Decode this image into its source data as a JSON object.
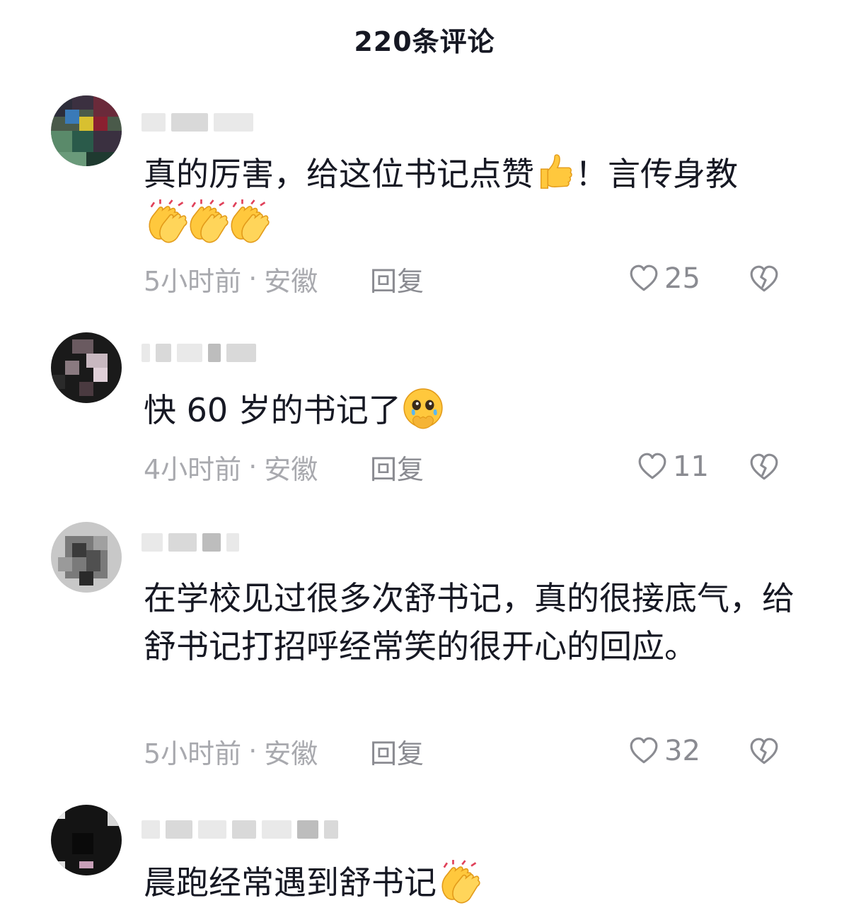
{
  "header": {
    "title": "220条评论"
  },
  "comments": [
    {
      "username": "",
      "text": "真的厉害，给这位书记点赞",
      "text_after_emoji": "！言传身教",
      "emojis": [
        "thumbs-up-emoji",
        "clapping-hands-emoji",
        "clapping-hands-emoji",
        "clapping-hands-emoji"
      ],
      "time": "5小时前",
      "separator": "·",
      "location": "安徽",
      "reply_label": "回复",
      "likes": "25"
    },
    {
      "username": "",
      "text": "快 60 岁的书记了",
      "emojis": [
        "face-holding-back-tears-emoji"
      ],
      "time": "4小时前",
      "separator": "·",
      "location": "安徽",
      "reply_label": "回复",
      "likes": "11"
    },
    {
      "username": "",
      "text": "在学校见过很多次舒书记，真的很接底气，给舒书记打招呼经常笑的很开心的回应。",
      "emojis": [],
      "time": "5小时前",
      "separator": "·",
      "location": "安徽",
      "reply_label": "回复",
      "likes": "32"
    },
    {
      "username": "",
      "text": "晨跑经常遇到舒书记",
      "emojis": [
        "clapping-hands-emoji"
      ]
    }
  ],
  "icons": {
    "like": "heart-outline-icon",
    "dislike": "broken-heart-icon"
  },
  "colors": {
    "text_primary": "#161823",
    "text_secondary": "#a8a9ae",
    "action_gray": "#8a8b91",
    "emoji_yellow": "#ffc83d"
  }
}
